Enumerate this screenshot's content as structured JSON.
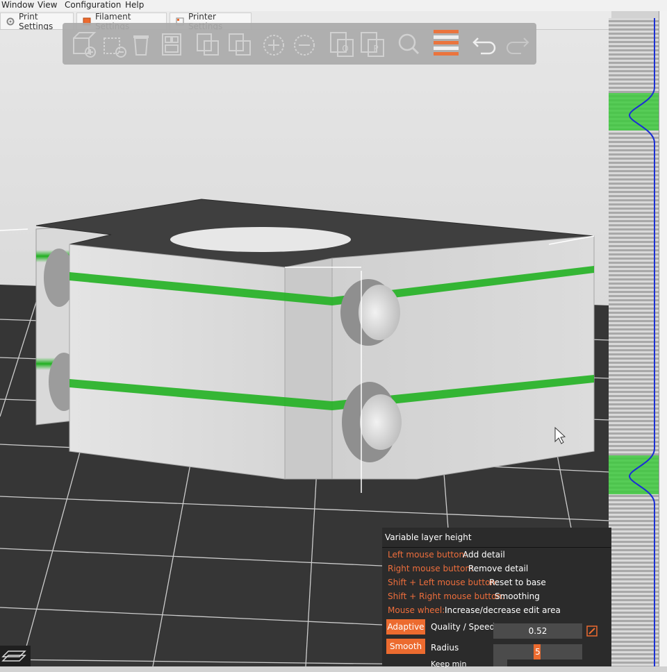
{
  "menu": {
    "items": [
      "Window",
      "View",
      "Configuration",
      "Help"
    ]
  },
  "tabs": [
    {
      "label": "Print Settings",
      "icon": "gear-icon"
    },
    {
      "label": "Filament Settings",
      "icon": "filament-spool-icon"
    },
    {
      "label": "Printer Settings",
      "icon": "printer-icon"
    }
  ],
  "toolbar": {
    "tools": [
      {
        "name": "add-object",
        "icon": "add-cube-icon"
      },
      {
        "name": "delete-object",
        "icon": "delete-cube-icon"
      },
      {
        "name": "delete-all",
        "icon": "trash-icon"
      },
      {
        "name": "arrange",
        "icon": "arrange-icon"
      },
      {
        "name": "copy",
        "icon": "copy-icon"
      },
      {
        "name": "paste",
        "icon": "paste-icon"
      },
      {
        "name": "add-instance",
        "icon": "plus-circle-icon"
      },
      {
        "name": "remove-instance",
        "icon": "minus-circle-icon"
      },
      {
        "name": "split-objects",
        "icon": "split-objects-icon"
      },
      {
        "name": "split-parts",
        "icon": "split-parts-icon"
      },
      {
        "name": "search",
        "icon": "search-icon"
      },
      {
        "name": "variable-layer-height",
        "icon": "layers-icon",
        "active": true
      },
      {
        "name": "undo",
        "icon": "undo-icon"
      },
      {
        "name": "redo",
        "icon": "redo-icon"
      }
    ]
  },
  "colors": {
    "accent": "#ec6b2f",
    "highlight_band": "#2fbf2f",
    "bed": "#3a3a3a",
    "model": "#d8d8d8",
    "layer_curve": "#1a2fd6"
  },
  "variable_layer_height": {
    "title": "Variable layer height",
    "shortcuts": [
      {
        "key": "Left mouse button:",
        "action": "Add detail"
      },
      {
        "key": "Right mouse button:",
        "action": "Remove detail"
      },
      {
        "key": "Shift + Left mouse button:",
        "action": "Reset to base"
      },
      {
        "key": "Shift + Right mouse button:",
        "action": "Smoothing"
      },
      {
        "key": "Mouse wheel:",
        "action": "Increase/decrease edit area"
      }
    ],
    "adaptive": {
      "button": "Adaptive",
      "label": "Quality / Speed",
      "value": "0.52"
    },
    "smooth": {
      "button": "Smooth",
      "label": "Radius",
      "value": "5"
    },
    "keep_min_label": "Keep min"
  }
}
